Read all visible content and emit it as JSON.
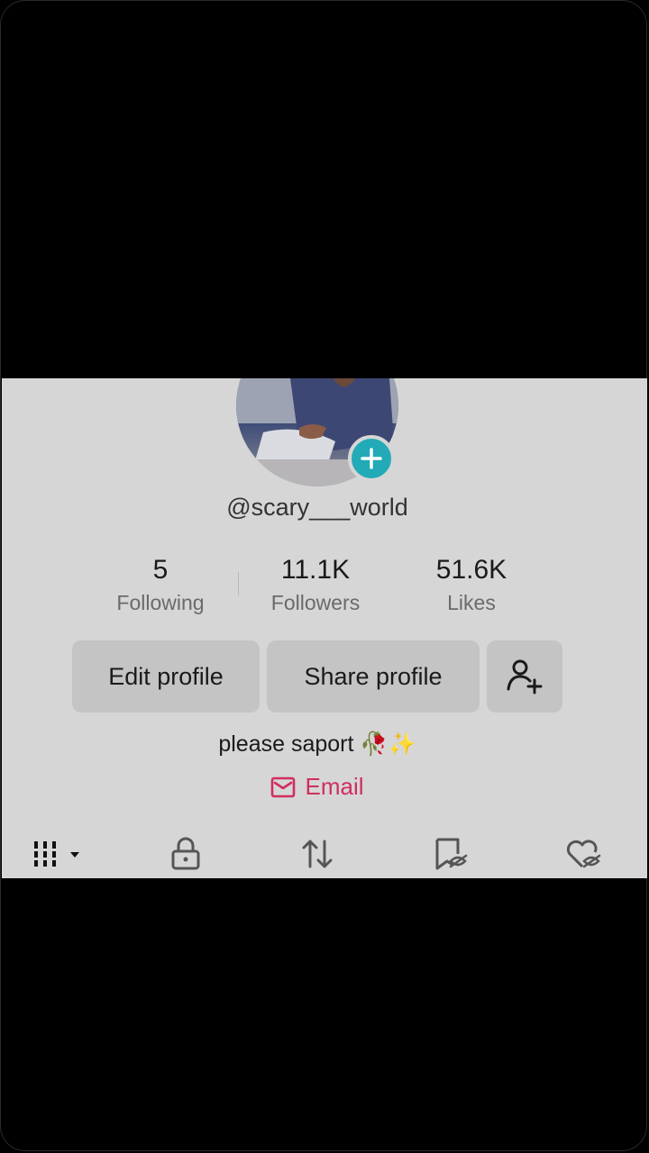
{
  "profile": {
    "username": "@scary___world",
    "bio": "please saport 🥀✨",
    "email_label": "Email"
  },
  "stats": [
    {
      "value": "5",
      "label": "Following"
    },
    {
      "value": "11.1K",
      "label": "Followers"
    },
    {
      "value": "51.6K",
      "label": "Likes"
    }
  ],
  "buttons": {
    "edit": "Edit profile",
    "share": "Share profile"
  },
  "tabs": [
    {
      "icon": "grid-icon"
    },
    {
      "icon": "lock-icon"
    },
    {
      "icon": "repost-icon"
    },
    {
      "icon": "bookmark-hidden-icon"
    },
    {
      "icon": "heart-hidden-icon"
    }
  ],
  "colors": {
    "background": "#d6d6d6",
    "accent_teal": "#22aab7",
    "email_pink": "#cf2f5f",
    "button_bg": "#c4c4c4"
  }
}
